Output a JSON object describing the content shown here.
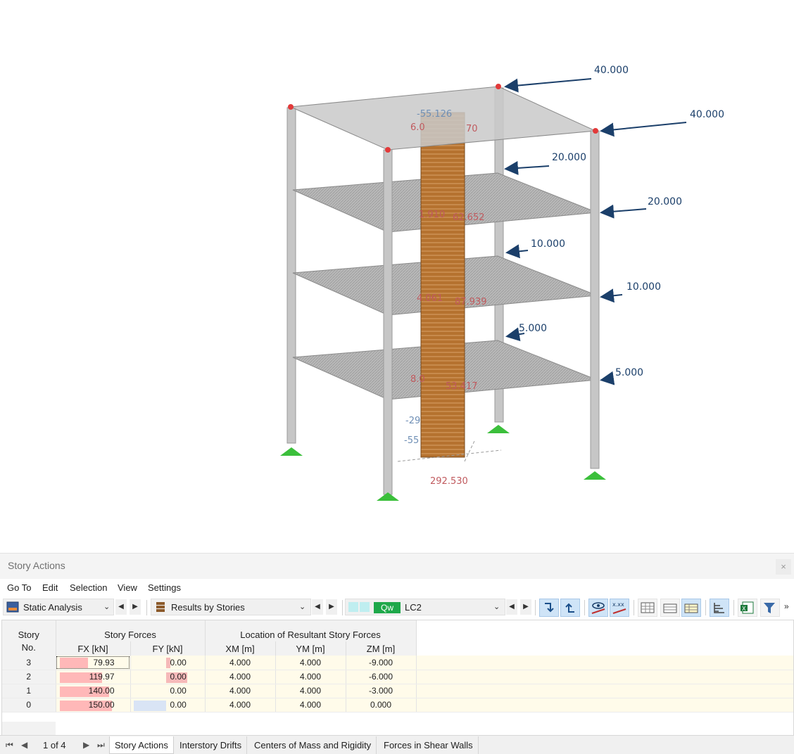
{
  "model": {
    "loads_left": [
      "40.000",
      "20.000",
      "10.000",
      "5.000"
    ],
    "loads_right": [
      "40.000",
      "20.000",
      "10.000",
      "5.000"
    ],
    "result_labels": {
      "top": [
        "-55.126",
        "6.0",
        "70"
      ],
      "floor3": [
        "1.910",
        "62.652"
      ],
      "floor2": [
        "4.061",
        "87.939"
      ],
      "floor1": [
        "8.0",
        "53.417"
      ],
      "base": [
        "-29",
        "-55",
        "292.530"
      ]
    }
  },
  "panel": {
    "title": "Story Actions",
    "close": "×"
  },
  "menu": [
    "Go To",
    "Edit",
    "Selection",
    "View",
    "Settings"
  ],
  "toolbar": {
    "analysis": "Static Analysis",
    "results": "Results by Stories",
    "lc_badge": "Qw",
    "lc_name": "LC2"
  },
  "table": {
    "col_story": [
      "Story",
      "No."
    ],
    "group_forces": "Story Forces",
    "group_location": "Location of Resultant Story Forces",
    "columns": [
      "FX [kN]",
      "FY [kN]",
      "XM [m]",
      "YM [m]",
      "ZM [m]"
    ],
    "rows": [
      {
        "story": "3",
        "fx": "79.93",
        "fy": "0.00",
        "xm": "4.000",
        "ym": "4.000",
        "zm": "-9.000"
      },
      {
        "story": "2",
        "fx": "119.97",
        "fy": "0.00",
        "xm": "4.000",
        "ym": "4.000",
        "zm": "-6.000"
      },
      {
        "story": "1",
        "fx": "140.00",
        "fy": "0.00",
        "xm": "4.000",
        "ym": "4.000",
        "zm": "-3.000"
      },
      {
        "story": "0",
        "fx": "150.00",
        "fy": "0.00",
        "xm": "4.000",
        "ym": "4.000",
        "zm": "0.000"
      }
    ]
  },
  "pager": "1 of 4",
  "tabs": [
    "Story Actions",
    "Interstory Drifts",
    "Centers of Mass and Rigidity",
    "Forces in Shear Walls"
  ],
  "colors": {
    "load_arrow": "#1b3f6a",
    "result_red": "#c05a5e",
    "fx_bar": "#ffb8b8",
    "fy_bar_pink": "#f6b9b9",
    "fy_bar_blue": "#d9e4f5",
    "lc_badge": "#1ea84a",
    "row_fill": "#fffbea"
  }
}
